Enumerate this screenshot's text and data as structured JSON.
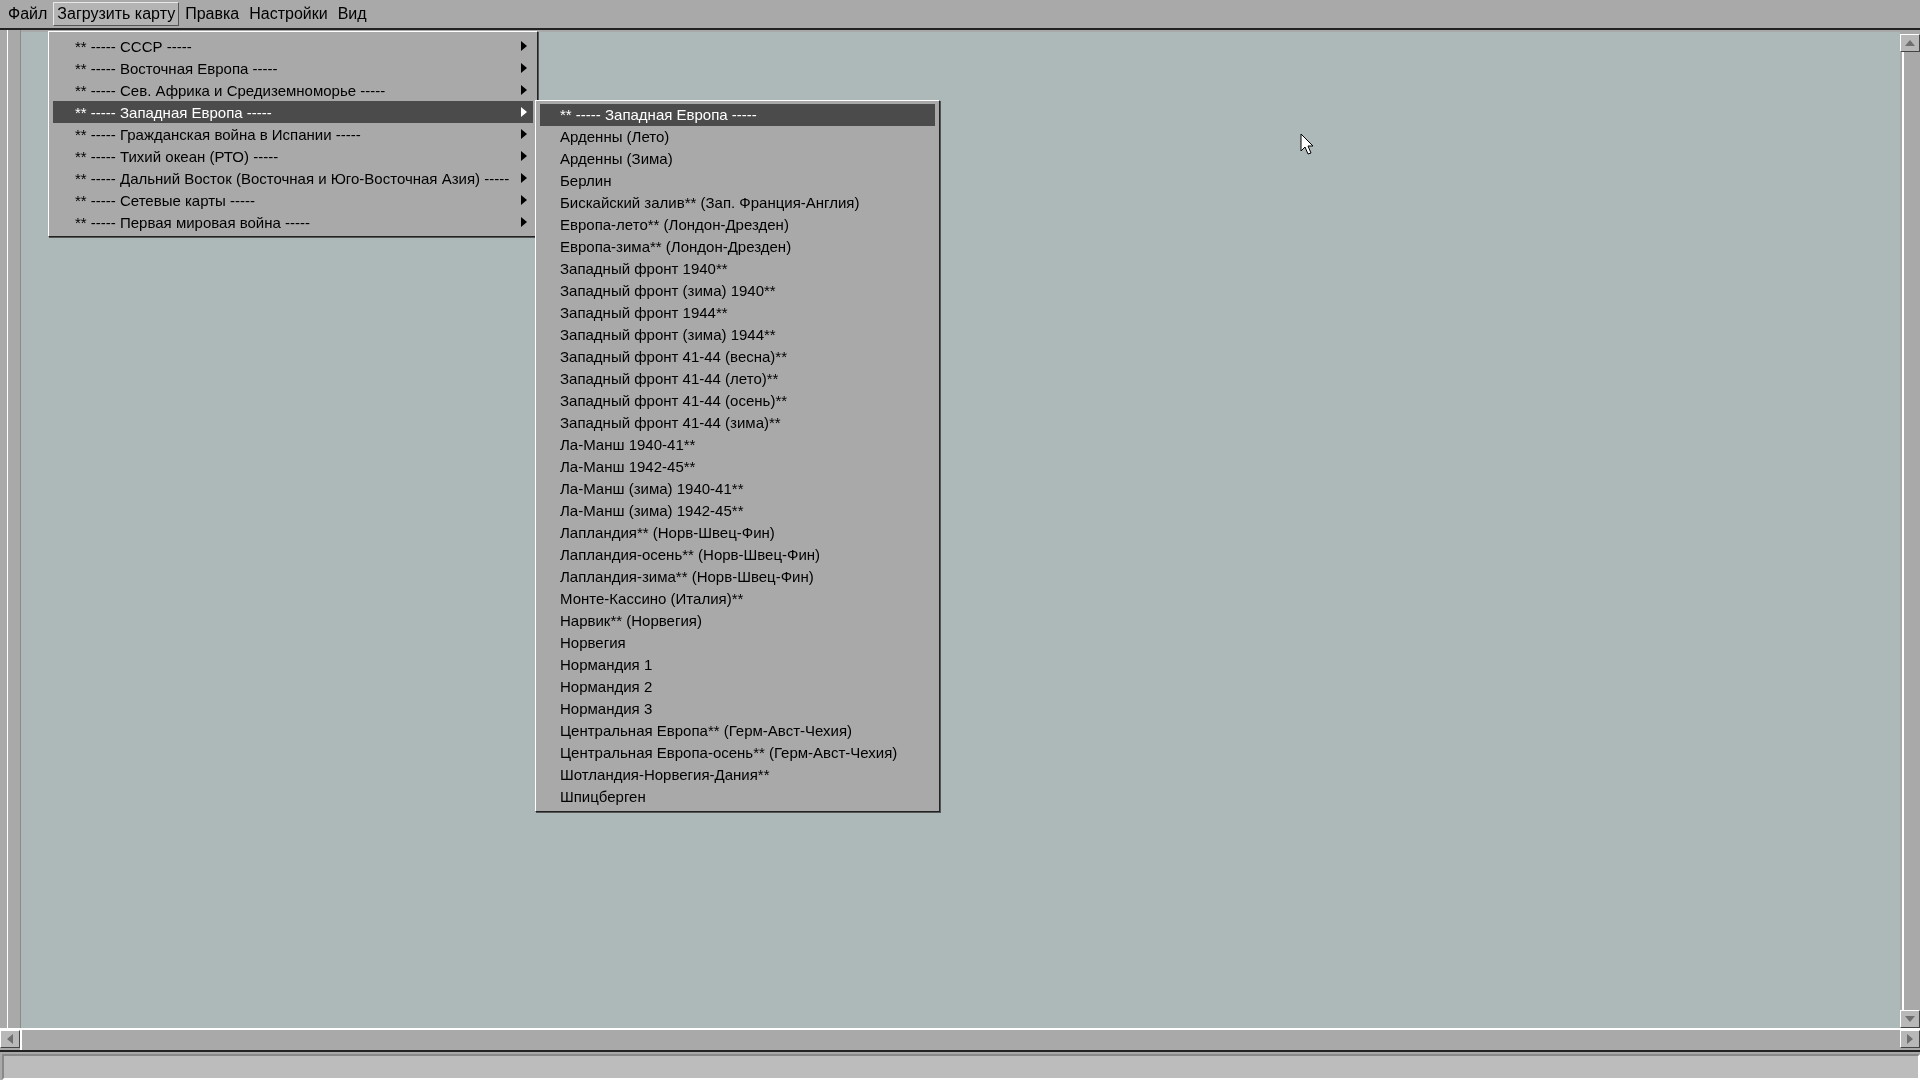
{
  "menubar": [
    {
      "label": "Файл",
      "selected": false
    },
    {
      "label": "Загрузить карту",
      "selected": true
    },
    {
      "label": "Правка",
      "selected": false
    },
    {
      "label": "Настройки",
      "selected": false
    },
    {
      "label": "Вид",
      "selected": false
    }
  ],
  "menu": {
    "items": [
      {
        "label": "** ----- СССР -----",
        "selected": false
      },
      {
        "label": "** ----- Восточная Европа -----",
        "selected": false
      },
      {
        "label": "** ----- Сев. Африка и Средиземноморье -----",
        "selected": false
      },
      {
        "label": "** ----- Западная Европа -----",
        "selected": true
      },
      {
        "label": "** ----- Гражданская война в Испании -----",
        "selected": false
      },
      {
        "label": "** ----- Тихий океан (РТО) -----",
        "selected": false
      },
      {
        "label": "** ----- Дальний Восток (Восточная и Юго-Восточная Азия) -----",
        "selected": false
      },
      {
        "label": "** ----- Сетевые карты -----",
        "selected": false
      },
      {
        "label": "** ----- Первая мировая война -----",
        "selected": false
      }
    ]
  },
  "submenu": {
    "items": [
      {
        "label": "** ----- Западная Европа -----",
        "selected": true
      },
      {
        "label": "Арденны (Лето)",
        "selected": false
      },
      {
        "label": "Арденны (Зима)",
        "selected": false
      },
      {
        "label": "Берлин",
        "selected": false
      },
      {
        "label": "Бискайский залив** (Зап. Франция-Англия)",
        "selected": false
      },
      {
        "label": "Европа-лето** (Лондон-Дрезден)",
        "selected": false
      },
      {
        "label": "Европа-зима** (Лондон-Дрезден)",
        "selected": false
      },
      {
        "label": "Западный фронт 1940**",
        "selected": false
      },
      {
        "label": "Западный фронт (зима) 1940**",
        "selected": false
      },
      {
        "label": "Западный фронт 1944**",
        "selected": false
      },
      {
        "label": "Западный фронт  (зима) 1944**",
        "selected": false
      },
      {
        "label": "Западный фронт 41-44 (весна)**",
        "selected": false
      },
      {
        "label": "Западный фронт 41-44 (лето)**",
        "selected": false
      },
      {
        "label": "Западный фронт 41-44 (осень)**",
        "selected": false
      },
      {
        "label": "Западный фронт 41-44 (зима)**",
        "selected": false
      },
      {
        "label": "Ла-Манш 1940-41**",
        "selected": false
      },
      {
        "label": "Ла-Манш 1942-45**",
        "selected": false
      },
      {
        "label": "Ла-Манш (зима) 1940-41**",
        "selected": false
      },
      {
        "label": "Ла-Манш (зима) 1942-45**",
        "selected": false
      },
      {
        "label": "Лапландия** (Норв-Швец-Фин)",
        "selected": false
      },
      {
        "label": "Лапландия-осень** (Норв-Швец-Фин)",
        "selected": false
      },
      {
        "label": "Лапландия-зима** (Норв-Швец-Фин)",
        "selected": false
      },
      {
        "label": "Монте-Кассино (Италия)**",
        "selected": false
      },
      {
        "label": "Нарвик** (Норвегия)",
        "selected": false
      },
      {
        "label": "Норвегия",
        "selected": false
      },
      {
        "label": "Нормандия 1",
        "selected": false
      },
      {
        "label": "Нормандия 2",
        "selected": false
      },
      {
        "label": "Нормандия 3",
        "selected": false
      },
      {
        "label": "Центральная Европа** (Герм-Авст-Чехия)",
        "selected": false
      },
      {
        "label": "Центральная Европа-осень** (Герм-Авст-Чехия)",
        "selected": false
      },
      {
        "label": "Шотландия-Норвегия-Дания**",
        "selected": false
      },
      {
        "label": "Шпицберген",
        "selected": false
      }
    ]
  }
}
